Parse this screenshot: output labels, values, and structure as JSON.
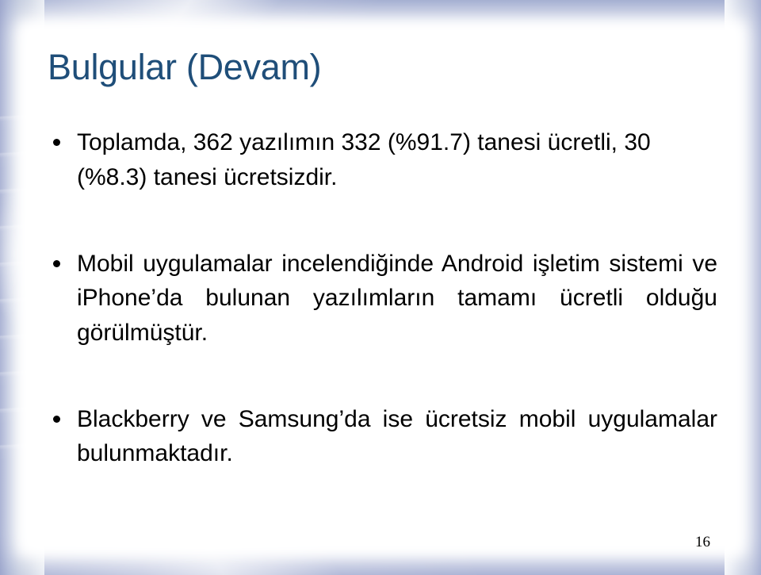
{
  "slide": {
    "title": "Bulgular (Devam)",
    "page_number": "16",
    "title_color": "#1F4E79",
    "body_color": "#000000",
    "frame_color": "#b7c0dc",
    "bullets": [
      {
        "text": "Toplamda, 362 yazılımın 332 (%91.7) tanesi ücretli, 30 (%8.3) tanesi ücretsizdir.",
        "justified": false
      },
      {
        "text": "Mobil uygulamalar incelendiğinde Android işletim sistemi ve iPhone’da bulunan yazılımların tamamı ücretli olduğu görülmüştür.",
        "justified": true
      },
      {
        "text": "Blackberry ve Samsung’da ise ücretsiz mobil uygulamalar bulunmaktadır.",
        "justified": true
      }
    ]
  }
}
